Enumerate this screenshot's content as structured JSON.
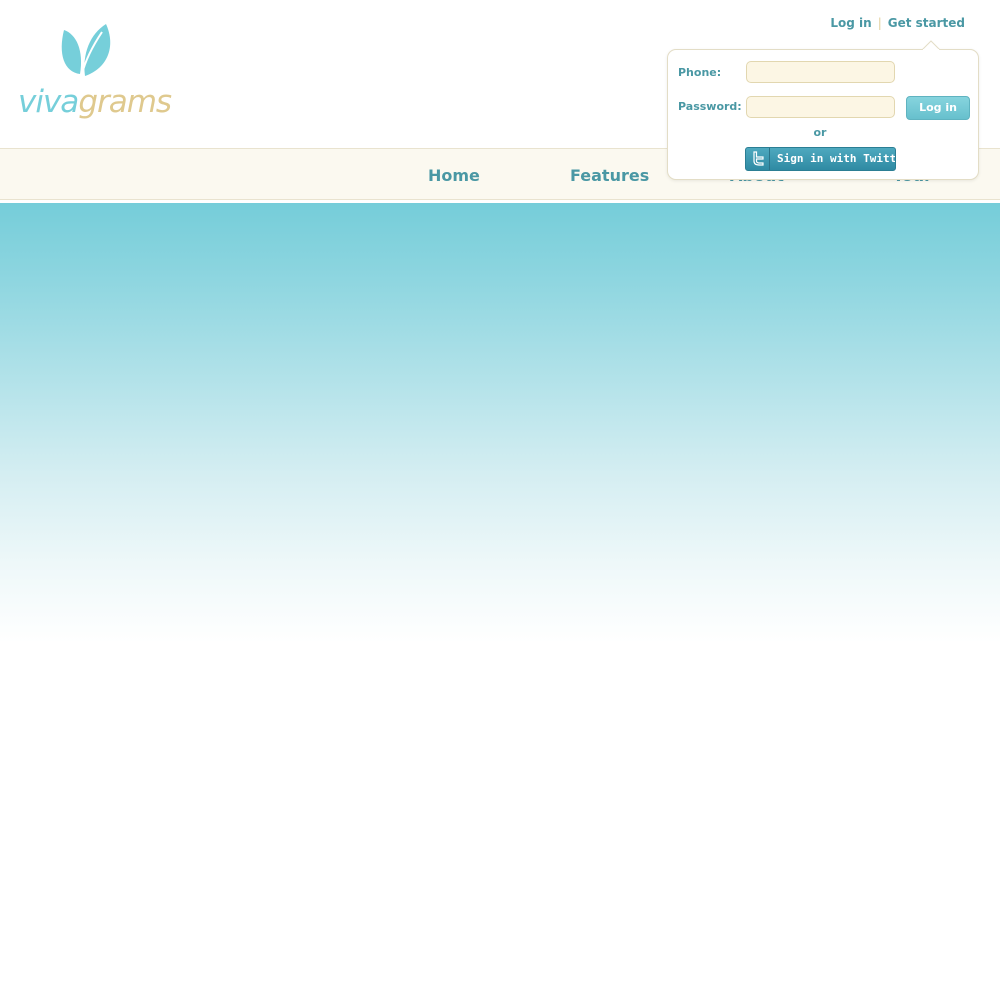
{
  "brand": {
    "logo_part1": "viva",
    "logo_part2": "grams",
    "logo_icon": "leaf-v-icon",
    "colors": {
      "primary_teal": "#76cfda",
      "accent_gold": "#dfc98e",
      "text_teal": "#4a98a4"
    }
  },
  "top_links": {
    "login": "Log in",
    "separator": "|",
    "get_started": "Get started"
  },
  "nav": {
    "items": [
      {
        "label": "Home"
      },
      {
        "label": "Features"
      },
      {
        "label": "About"
      },
      {
        "label": "Tour"
      }
    ]
  },
  "login_popup": {
    "phone_label": "Phone:",
    "phone_value": "",
    "password_label": "Password:",
    "password_value": "",
    "login_button": "Log in",
    "or_text": "or",
    "twitter_button": "Sign in with Twitter",
    "twitter_icon": "twitter-bird-icon"
  }
}
